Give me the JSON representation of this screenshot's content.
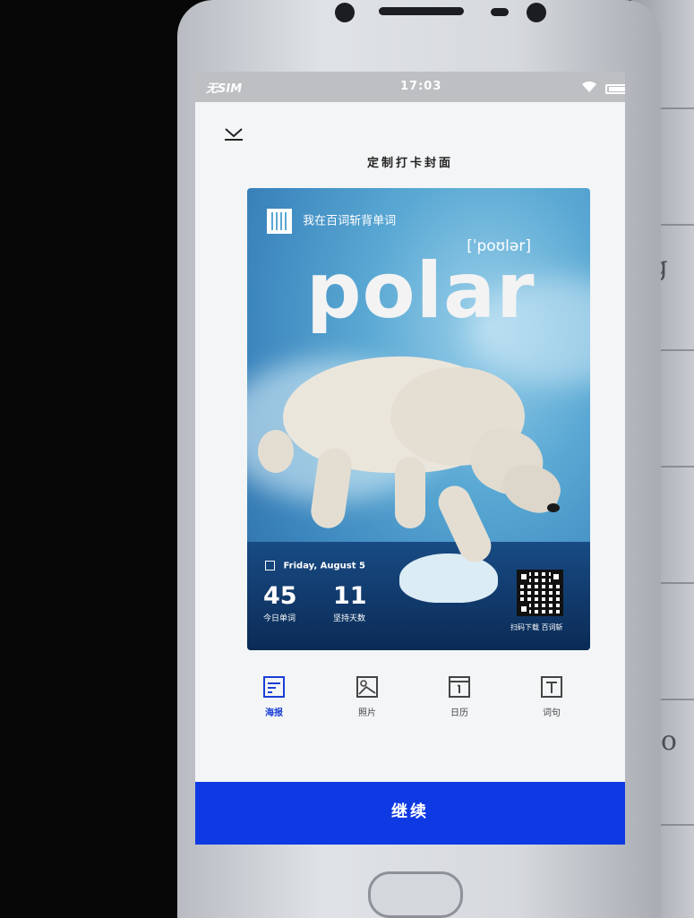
{
  "statusbar": {
    "carrier": "无SIM",
    "time": "17:03"
  },
  "page": {
    "title": "定制打卡封面"
  },
  "poster": {
    "header_text": "我在百词斩背单词",
    "word": "polar",
    "phonetic": "[ˈpoʊlər]",
    "date": "Friday, August 5",
    "stats": [
      {
        "value": "45",
        "label": "今日单词"
      },
      {
        "value": "11",
        "label": "坚持天数"
      }
    ],
    "qr_caption": "扫码下载 百词斩"
  },
  "tabs": [
    {
      "label": "海报",
      "icon": "poster-icon",
      "active": true
    },
    {
      "label": "照片",
      "icon": "photo-icon",
      "active": false
    },
    {
      "label": "日历",
      "icon": "calendar-icon",
      "active": false
    },
    {
      "label": "词句",
      "icon": "text-icon",
      "active": false
    }
  ],
  "actions": {
    "continue_label": "继续"
  },
  "colors": {
    "accent": "#0f3ae3",
    "active_tab": "#1a3fd6"
  }
}
